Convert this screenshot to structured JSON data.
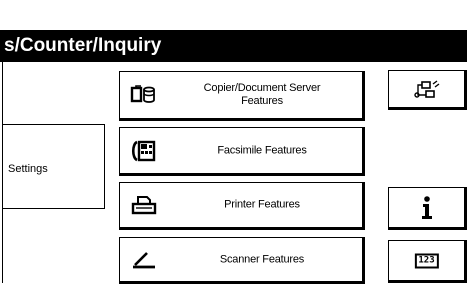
{
  "header": {
    "title": "s/Counter/Inquiry"
  },
  "left_panel": {
    "settings_label": "Settings"
  },
  "features": [
    {
      "label_line1": "Copier/Document Server",
      "label_line2": "Features",
      "icon": "copier-icon"
    },
    {
      "label": "Facsimile Features",
      "icon": "facsimile-icon"
    },
    {
      "label": "Printer Features",
      "icon": "printer-icon"
    },
    {
      "label": "Scanner Features",
      "icon": "scanner-icon"
    }
  ],
  "right_panel": {
    "icons": [
      "network-connection-icon",
      "info-icon",
      "counter-icon"
    ],
    "counter_text": "123"
  }
}
